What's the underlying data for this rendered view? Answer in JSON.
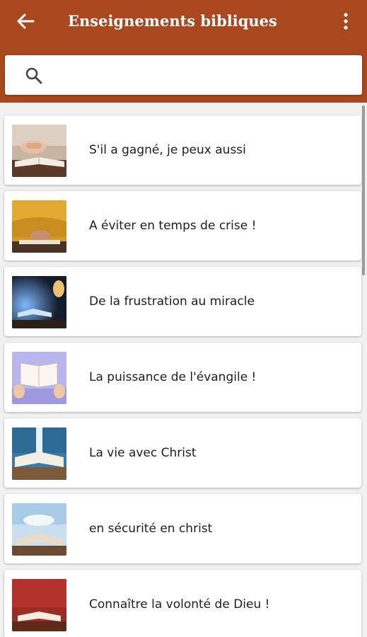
{
  "app_bar": {
    "title": "Enseignements bibliques",
    "back_icon": "arrow-left-icon",
    "more_icon": "more-vertical-icon",
    "color": "#a9481e"
  },
  "search": {
    "icon": "search-icon",
    "value": "",
    "placeholder": ""
  },
  "teachings": [
    {
      "title": "S'il a gagné, je peux aussi"
    },
    {
      "title": "A éviter en temps de crise !"
    },
    {
      "title": "De la frustration au miracle"
    },
    {
      "title": "La puissance de l'évangile !"
    },
    {
      "title": "La vie avec Christ"
    },
    {
      "title": "en sécurité en christ"
    },
    {
      "title": "Connaître la volonté de Dieu !"
    }
  ]
}
